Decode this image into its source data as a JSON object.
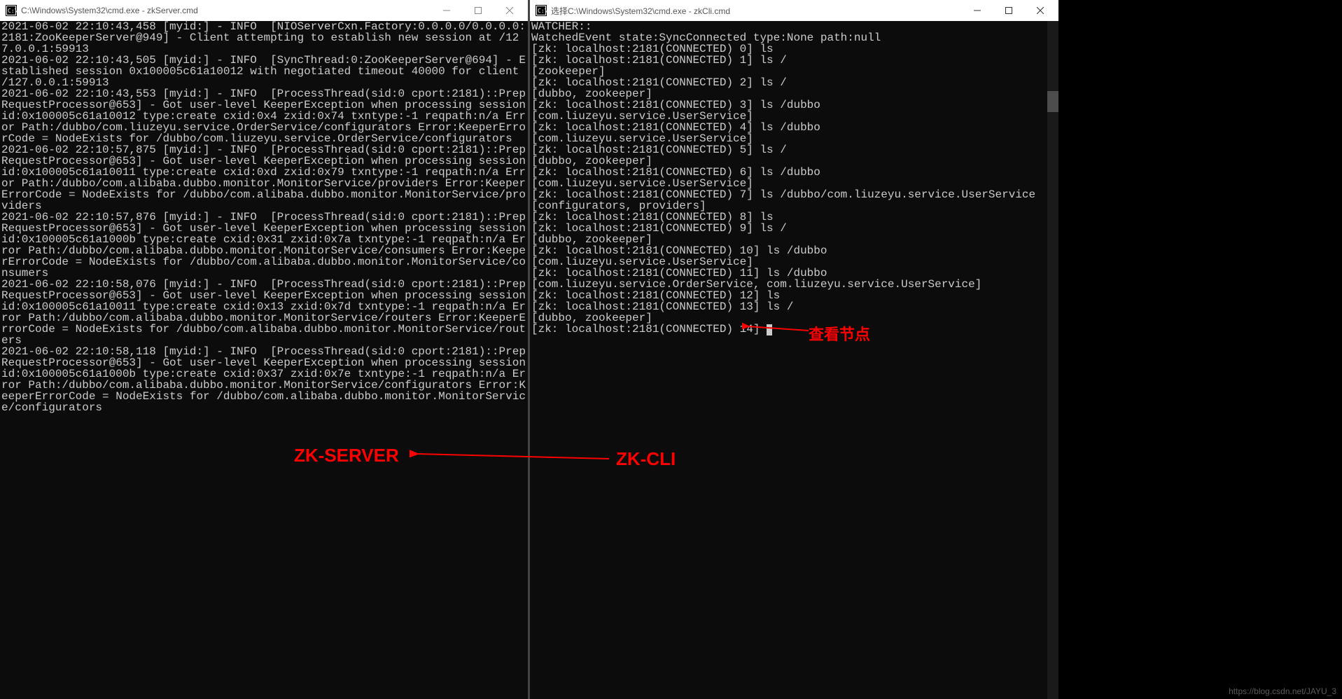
{
  "left_window": {
    "title": "C:\\Windows\\System32\\cmd.exe - zkServer.cmd",
    "lines": [
      "2021-06-02 22:10:43,458 [myid:] - INFO  [NIOServerCxn.Factory:0.0.0.0/0.0.0.0:2181:ZooKeeperServer@949] - Client attempting to establish new session at /127.0.0.1:59913",
      "2021-06-02 22:10:43,505 [myid:] - INFO  [SyncThread:0:ZooKeeperServer@694] - Established session 0x100005c61a10012 with negotiated timeout 40000 for client /127.0.0.1:59913",
      "2021-06-02 22:10:43,553 [myid:] - INFO  [ProcessThread(sid:0 cport:2181)::PrepRequestProcessor@653] - Got user-level KeeperException when processing sessionid:0x100005c61a10012 type:create cxid:0x4 zxid:0x74 txntype:-1 reqpath:n/a Error Path:/dubbo/com.liuzeyu.service.OrderService/configurators Error:KeeperErrorCode = NodeExists for /dubbo/com.liuzeyu.service.OrderService/configurators",
      "2021-06-02 22:10:57,875 [myid:] - INFO  [ProcessThread(sid:0 cport:2181)::PrepRequestProcessor@653] - Got user-level KeeperException when processing sessionid:0x100005c61a10011 type:create cxid:0xd zxid:0x79 txntype:-1 reqpath:n/a Error Path:/dubbo/com.alibaba.dubbo.monitor.MonitorService/providers Error:KeeperErrorCode = NodeExists for /dubbo/com.alibaba.dubbo.monitor.MonitorService/providers",
      "2021-06-02 22:10:57,876 [myid:] - INFO  [ProcessThread(sid:0 cport:2181)::PrepRequestProcessor@653] - Got user-level KeeperException when processing sessionid:0x100005c61a1000b type:create cxid:0x31 zxid:0x7a txntype:-1 reqpath:n/a Error Path:/dubbo/com.alibaba.dubbo.monitor.MonitorService/consumers Error:KeeperErrorCode = NodeExists for /dubbo/com.alibaba.dubbo.monitor.MonitorService/consumers",
      "2021-06-02 22:10:58,076 [myid:] - INFO  [ProcessThread(sid:0 cport:2181)::PrepRequestProcessor@653] - Got user-level KeeperException when processing sessionid:0x100005c61a10011 type:create cxid:0x13 zxid:0x7d txntype:-1 reqpath:n/a Error Path:/dubbo/com.alibaba.dubbo.monitor.MonitorService/routers Error:KeeperErrorCode = NodeExists for /dubbo/com.alibaba.dubbo.monitor.MonitorService/routers",
      "2021-06-02 22:10:58,118 [myid:] - INFO  [ProcessThread(sid:0 cport:2181)::PrepRequestProcessor@653] - Got user-level KeeperException when processing sessionid:0x100005c61a1000b type:create cxid:0x37 zxid:0x7e txntype:-1 reqpath:n/a Error Path:/dubbo/com.alibaba.dubbo.monitor.MonitorService/configurators Error:KeeperErrorCode = NodeExists for /dubbo/com.alibaba.dubbo.monitor.MonitorService/configurators"
    ]
  },
  "right_window": {
    "title": "选择C:\\Windows\\System32\\cmd.exe - zkCli.cmd",
    "lines": [
      "WATCHER::",
      "",
      "WatchedEvent state:SyncConnected type:None path:null",
      "",
      "[zk: localhost:2181(CONNECTED) 0] ls",
      "[zk: localhost:2181(CONNECTED) 1] ls /",
      "[zookeeper]",
      "[zk: localhost:2181(CONNECTED) 2] ls /",
      "[dubbo, zookeeper]",
      "[zk: localhost:2181(CONNECTED) 3] ls /dubbo",
      "[com.liuzeyu.service.UserService]",
      "[zk: localhost:2181(CONNECTED) 4] ls /dubbo",
      "[com.liuzeyu.service.UserService]",
      "[zk: localhost:2181(CONNECTED) 5] ls /",
      "[dubbo, zookeeper]",
      "[zk: localhost:2181(CONNECTED) 6] ls /dubbo",
      "[com.liuzeyu.service.UserService]",
      "[zk: localhost:2181(CONNECTED) 7] ls /dubbo/com.liuzeyu.service.UserService",
      "[configurators, providers]",
      "[zk: localhost:2181(CONNECTED) 8] ls",
      "[zk: localhost:2181(CONNECTED) 9] ls /",
      "[dubbo, zookeeper]",
      "[zk: localhost:2181(CONNECTED) 10] ls /dubbo",
      "[com.liuzeyu.service.UserService]",
      "[zk: localhost:2181(CONNECTED) 11] ls /dubbo",
      "[com.liuzeyu.service.OrderService, com.liuzeyu.service.UserService]",
      "[zk: localhost:2181(CONNECTED) 12] ls",
      "[zk: localhost:2181(CONNECTED) 13] ls /",
      "[dubbo, zookeeper]",
      "[zk: localhost:2181(CONNECTED) 14] "
    ]
  },
  "annotations": {
    "zkserver": "ZK-SERVER",
    "zkcli": "ZK-CLI",
    "viewnode": "查看节点"
  },
  "watermark": "https://blog.csdn.net/JAYU_3"
}
